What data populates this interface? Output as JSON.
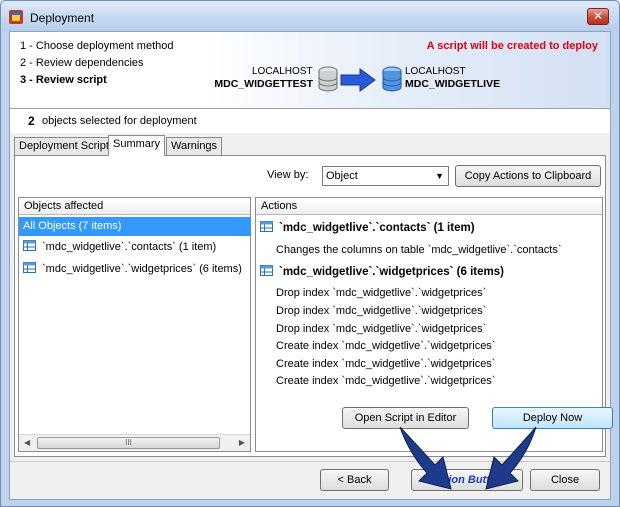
{
  "window": {
    "title": "Deployment",
    "close_glyph": "✕"
  },
  "steps": [
    {
      "label": "1 - Choose deployment method",
      "active": false
    },
    {
      "label": "2 - Review dependencies",
      "active": false
    },
    {
      "label": "3 - Review script",
      "active": true
    }
  ],
  "banner": {
    "warning": "A script will be created to deploy",
    "source": {
      "host": "LOCALHOST",
      "database": "MDC_WIDGETTEST"
    },
    "target": {
      "host": "LOCALHOST",
      "database": "MDC_WIDGETLIVE"
    }
  },
  "selection": {
    "count": "2",
    "label": "objects selected for deployment"
  },
  "tabs": [
    {
      "label": "Deployment Script",
      "active": false
    },
    {
      "label": "Summary",
      "active": true
    },
    {
      "label": "Warnings",
      "active": false
    }
  ],
  "view_by": {
    "label": "View by:",
    "value": "Object"
  },
  "copy_button": "Copy Actions to Clipboard",
  "objects_pane": {
    "header": "Objects affected",
    "rows": [
      {
        "label": "All Objects (7 items)",
        "selected": true,
        "icon": null
      },
      {
        "label": "`mdc_widgetlive`.`contacts` (1 item)",
        "selected": false,
        "icon": "table-icon"
      },
      {
        "label": "`mdc_widgetlive`.`widgetprices` (6 items)",
        "selected": false,
        "icon": "table-icon"
      }
    ],
    "scroll_glyph": "III"
  },
  "actions_pane": {
    "header": "Actions",
    "groups": [
      {
        "heading": "`mdc_widgetlive`.`contacts` (1 item)",
        "lines": [
          "Changes the columns on table `mdc_widgetlive`.`contacts`"
        ]
      },
      {
        "heading": "`mdc_widgetlive`.`widgetprices` (6 items)",
        "lines": [
          "Drop index `mdc_widgetlive`.`widgetprices`",
          "Drop index `mdc_widgetlive`.`widgetprices`",
          "Drop index `mdc_widgetlive`.`widgetprices`",
          "Create index `mdc_widgetlive`.`widgetprices`",
          "Create index `mdc_widgetlive`.`widgetprices`",
          "Create index `mdc_widgetlive`.`widgetprices`"
        ]
      }
    ]
  },
  "buttons": {
    "open_script": "Open Script in Editor",
    "deploy_now": "Deploy Now",
    "back": "< Back",
    "action": "Action Button",
    "close": "Close"
  },
  "colors": {
    "warning": "#e0001a",
    "selection": "#3399ff",
    "action_text": "#1a3fb0",
    "arrow": "#1e3a8a"
  }
}
